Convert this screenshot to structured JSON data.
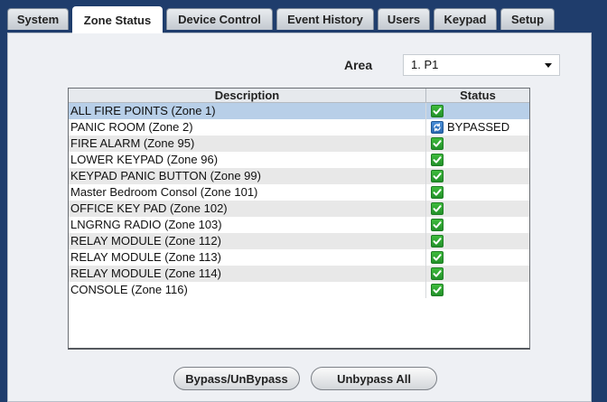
{
  "tabs": [
    {
      "label": "System",
      "active": false
    },
    {
      "label": "Zone Status",
      "active": true
    },
    {
      "label": "Device Control",
      "active": false
    },
    {
      "label": "Event History",
      "active": false
    },
    {
      "label": "Users",
      "active": false
    },
    {
      "label": "Keypad",
      "active": false
    },
    {
      "label": "Setup",
      "active": false
    }
  ],
  "area": {
    "label": "Area",
    "selected": "1. P1"
  },
  "table": {
    "headers": {
      "description": "Description",
      "status": "Status"
    },
    "rows": [
      {
        "description": "ALL FIRE POINTS   (Zone 1)",
        "status": "ok",
        "status_text": "",
        "selected": true
      },
      {
        "description": "PANIC ROOM   (Zone 2)",
        "status": "bypassed",
        "status_text": "BYPASSED",
        "selected": false
      },
      {
        "description": "FIRE ALARM   (Zone 95)",
        "status": "ok",
        "status_text": "",
        "selected": false
      },
      {
        "description": "LOWER KEYPAD   (Zone 96)",
        "status": "ok",
        "status_text": "",
        "selected": false
      },
      {
        "description": "KEYPAD PANIC BUTTON   (Zone 99)",
        "status": "ok",
        "status_text": "",
        "selected": false
      },
      {
        "description": "Master Bedroom Consol   (Zone 101)",
        "status": "ok",
        "status_text": "",
        "selected": false
      },
      {
        "description": "OFFICE KEY PAD   (Zone 102)",
        "status": "ok",
        "status_text": "",
        "selected": false
      },
      {
        "description": "LNGRNG RADIO   (Zone 103)",
        "status": "ok",
        "status_text": "",
        "selected": false
      },
      {
        "description": "RELAY MODULE   (Zone 112)",
        "status": "ok",
        "status_text": "",
        "selected": false
      },
      {
        "description": "RELAY MODULE   (Zone 113)",
        "status": "ok",
        "status_text": "",
        "selected": false
      },
      {
        "description": "RELAY MODULE   (Zone 114)",
        "status": "ok",
        "status_text": "",
        "selected": false
      },
      {
        "description": "CONSOLE   (Zone 116)",
        "status": "ok",
        "status_text": "",
        "selected": false
      }
    ]
  },
  "buttons": {
    "bypass": "Bypass/UnBypass",
    "unbypass_all": "Unbypass All"
  },
  "icons": {
    "ok": "check-icon",
    "bypassed": "bypass-icon"
  },
  "colors": {
    "background": "#1f3d6c",
    "selected_row": "#b8cfe8",
    "ok_green": "#2fa534",
    "bypass_blue": "#3b7fcc"
  }
}
